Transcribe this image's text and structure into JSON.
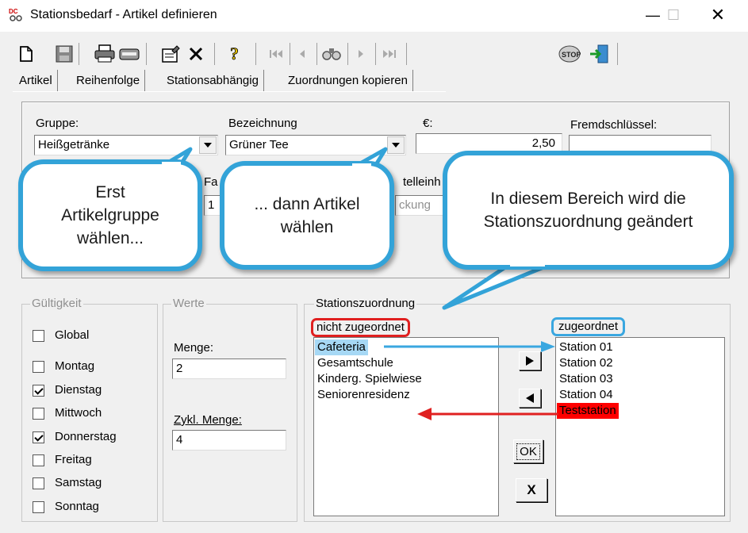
{
  "window": {
    "title": "Stationsbedarf - Artikel definieren",
    "minimize_glyph": "—",
    "maximize_glyph": "☐",
    "close_glyph": "✕"
  },
  "toolbar": {
    "icons": [
      "new-document-icon",
      "save-icon",
      "print-icon",
      "print-preview-icon",
      "properties-icon",
      "delete-icon",
      "help-icon",
      "first-record-icon",
      "previous-record-icon",
      "find-icon",
      "next-record-icon",
      "last-record-icon",
      "stop-icon",
      "exit-icon"
    ]
  },
  "tabs": [
    "Artikel",
    "Reihenfolge",
    "Stationsabhängig",
    "Zuordnungen kopieren"
  ],
  "article": {
    "gruppe_label": "Gruppe:",
    "gruppe_value": "Heißgetränke",
    "bezeichnung_label": "Bezeichnung",
    "bezeichnung_value": "Grüner Tee",
    "price_label": "€:",
    "price_value": "2,50",
    "fremd_label": "Fremdschlüssel:",
    "fremd_value": "",
    "fa_label": "Fa",
    "fa_value": "1",
    "bestell_label": "telleinh",
    "bestell_value": "ckung"
  },
  "gueltigkeit": {
    "title": "Gültigkeit",
    "items": [
      {
        "label": "Global",
        "checked": false
      },
      {
        "label": "Montag",
        "checked": false
      },
      {
        "label": "Dienstag",
        "checked": true
      },
      {
        "label": "Mittwoch",
        "checked": false
      },
      {
        "label": "Donnerstag",
        "checked": true
      },
      {
        "label": "Freitag",
        "checked": false
      },
      {
        "label": "Samstag",
        "checked": false
      },
      {
        "label": "Sonntag",
        "checked": false
      }
    ]
  },
  "werte": {
    "title": "Werte",
    "menge_label": "Menge:",
    "menge_value": "2",
    "zykl_label": "Zykl. Menge:",
    "zykl_value": "4"
  },
  "stations": {
    "title": "Stationszuordnung",
    "unassigned_label": "nicht zugeordnet",
    "assigned_label": "zugeordnet",
    "unassigned": [
      "Cafeteria",
      "Gesamtschule",
      "Kinderg. Spielwiese",
      "Seniorenresidenz"
    ],
    "assigned": [
      "Station 01",
      "Station 02",
      "Station 03",
      "Station 04",
      "Teststation"
    ],
    "ok_label": "OK",
    "cancel_label": "X"
  },
  "callouts": {
    "first": "Erst Artikelgruppe wählen...",
    "second": "... dann Artikel wählen",
    "third": "In diesem Bereich wird die Stationszuordnung geändert"
  },
  "colors": {
    "callout_border": "#33a3d8",
    "highlight_blue": "#3aa7e0",
    "highlight_red": "#e02020",
    "selected_blue_bg": "#a6d8f5",
    "selected_red_bg": "#ff0000"
  }
}
